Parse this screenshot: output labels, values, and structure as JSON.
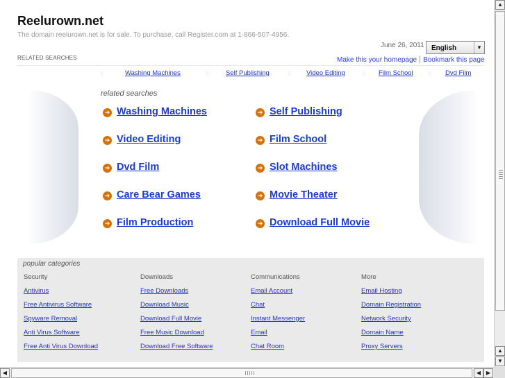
{
  "header": {
    "site_title": "Reelurown.net",
    "sale_notice": "The domain reelurown.net is for sale. To purchase, call Register.com at 1-866-507-4956.",
    "date": "June 26, 2011",
    "language": "English",
    "related_label": "RELATED SEARCHES",
    "make_homepage": "Make this your homepage",
    "bookmark": "Bookmark this page"
  },
  "link_bar": {
    "separator": "::",
    "items": [
      "Washing Machines",
      "Self Publishing",
      "Video Editing",
      "Film School",
      "Dvd Film"
    ]
  },
  "related": {
    "heading": "related searches",
    "arrow": "➔",
    "items": [
      "Washing Machines",
      "Self Publishing",
      "Video Editing",
      "Film School",
      "Dvd Film",
      "Slot Machines",
      "Care Bear Games",
      "Movie Theater",
      "Film Production",
      "Download Full Movie"
    ]
  },
  "popular": {
    "heading": "popular categories",
    "columns": [
      {
        "title": "Security",
        "links": [
          "Antivirus",
          "Free Antivirus Software",
          "Spyware Removal",
          "Anti Virus Software",
          "Free Anti Virus Download"
        ]
      },
      {
        "title": "Downloads",
        "links": [
          "Free Downloads",
          "Download Music",
          "Download Full Movie",
          "Free Music Download",
          "Download Free Software"
        ]
      },
      {
        "title": "Communications",
        "links": [
          "Email Account",
          "Chat",
          "Instant Messenger",
          "Email",
          "Chat Room"
        ]
      },
      {
        "title": "More",
        "links": [
          "Email Hosting",
          "Domain Registration",
          "Network Security",
          "Domain Name",
          "Proxy Servers"
        ]
      }
    ]
  },
  "scrollbars": {
    "up": "▲",
    "down": "▼",
    "down2": "▼",
    "up2": "▲",
    "left": "◀",
    "right": "▶",
    "left2": "◀"
  }
}
